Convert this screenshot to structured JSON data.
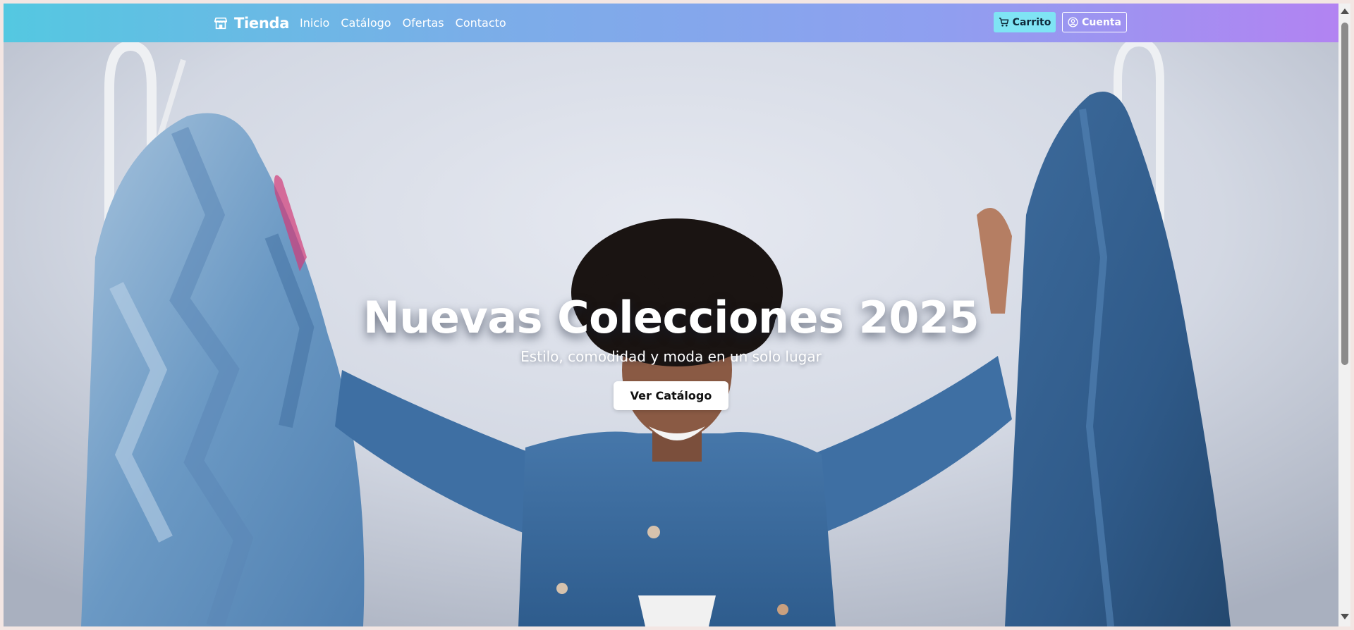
{
  "navbar": {
    "brand_icon": "storefront-icon",
    "brand_name": "Tienda",
    "links": [
      {
        "label": "Inicio"
      },
      {
        "label": "Catálogo"
      },
      {
        "label": "Ofertas"
      },
      {
        "label": "Contacto"
      }
    ],
    "cart": {
      "icon": "cart-icon",
      "label": "Carrito"
    },
    "account": {
      "icon": "user-circle-icon",
      "label": "Cuenta"
    }
  },
  "hero": {
    "title": "Nuevas Colecciones 2025",
    "subtitle": "Estilo, comodidad y moda en un solo lugar",
    "cta_label": "Ver Catálogo",
    "image": "woman-with-denim-jackets-on-clothing-racks"
  },
  "colors": {
    "navbar_gradient_start": "#54c8e1",
    "navbar_gradient_end": "#b283f2",
    "cart_button": "#7fe4f4",
    "cta_button": "#ffffff"
  }
}
